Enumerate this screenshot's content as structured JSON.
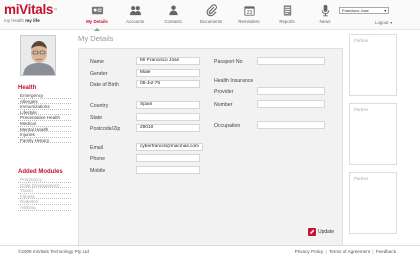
{
  "brand": {
    "name": "miVitals",
    "tagline_pre": "my health ",
    "tagline_bold": "my life"
  },
  "nav": [
    {
      "label": "My Details",
      "icon": "id-card-icon",
      "active": true
    },
    {
      "label": "Accounts",
      "icon": "people-icon",
      "active": false
    },
    {
      "label": "Contacts",
      "icon": "contacts-icon",
      "active": false
    },
    {
      "label": "Documents",
      "icon": "paperclip-icon",
      "active": false
    },
    {
      "label": "Reminders",
      "icon": "calendar-icon",
      "active": false
    },
    {
      "label": "Reports",
      "icon": "reports-icon",
      "active": false
    },
    {
      "label": "News",
      "icon": "microphone-icon",
      "active": false
    }
  ],
  "user_select": {
    "value": "Francisco Jose"
  },
  "logout": "Logout",
  "sidebar": {
    "health_title": "Health",
    "health_items": [
      "Emergency",
      "Allergies",
      "Immunizations",
      "Lifestyle",
      "Preventative Health",
      "Medical",
      "Mental Health",
      "Injuries",
      "Family History"
    ],
    "modules_title": "Added Modules",
    "module_items": [
      "Pregnancy",
      "Child Development",
      "Travel",
      "Fitness",
      "Diabetes",
      "Asthma"
    ]
  },
  "page_title": "My Details",
  "form": {
    "name_label": "Name",
    "name_value": "Mr Francisco Jose",
    "gender_label": "Gender",
    "gender_value": "Male",
    "dob_label": "Date of Birth",
    "dob_value": "05-Jul-75",
    "country_label": "Country",
    "country_value": "Spain",
    "state_label": "State",
    "state_value": "",
    "postcode_label": "Postcode/Zip",
    "postcode_value": "29010",
    "email_label": "Email",
    "email_value": "cyberfrancis@macmail.com",
    "phone_label": "Phone",
    "phone_value": "",
    "mobile_label": "Mobile",
    "mobile_value": "",
    "passport_label": "Passport No",
    "passport_value": "",
    "insurance_label": "Health Insurance",
    "provider_label": "Provider",
    "provider_value": "",
    "number_label": "Number",
    "number_value": "",
    "occupation_label": "Occupation",
    "occupation_value": ""
  },
  "update_label": "Update",
  "partners": [
    "Partner",
    "Partner",
    "Partner"
  ],
  "footer": {
    "copyright": "©2008 miVitals Technology Pty Ltd",
    "links": [
      "Privacy Policy",
      "Terms of Agreement",
      "Feedback"
    ]
  },
  "colors": {
    "brand": "#c41230",
    "panel": "#f2f2f2"
  }
}
